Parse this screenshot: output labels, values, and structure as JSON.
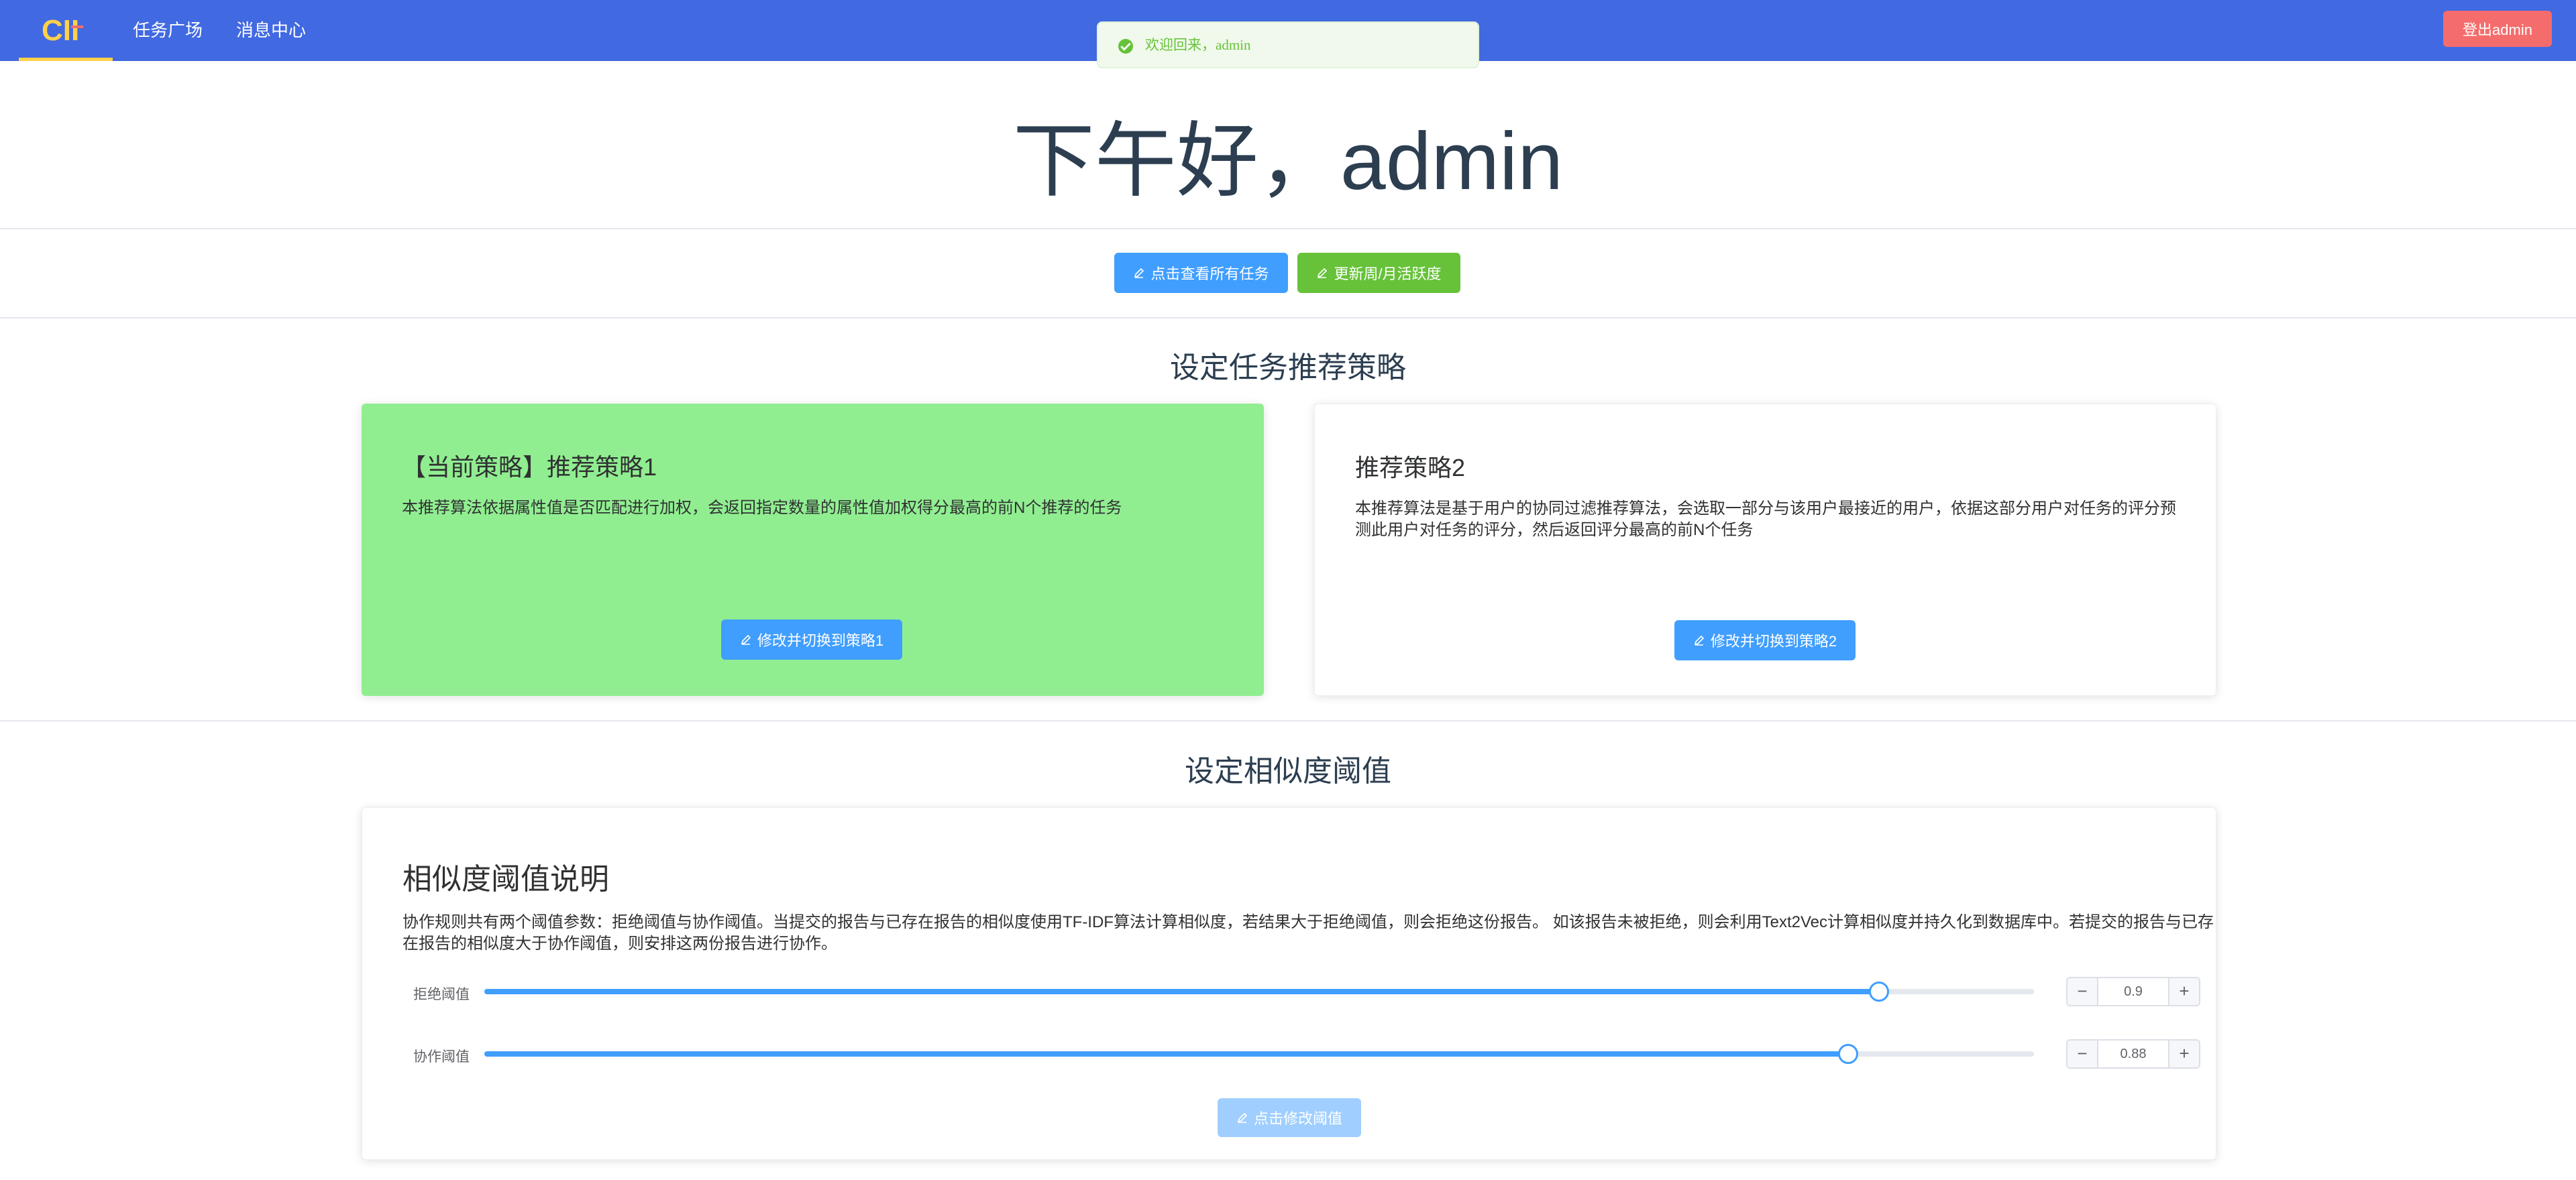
{
  "header": {
    "logo_text": "CII",
    "nav": [
      "任务广场",
      "消息中心"
    ],
    "logout_label": "登出admin"
  },
  "toast": {
    "icon": "success-check-icon",
    "message": "欢迎回来，admin"
  },
  "greeting": "下午好，admin",
  "actions": {
    "view_all_tasks": "点击查看所有任务",
    "update_activity": "更新周/月活跃度"
  },
  "strategy_section": {
    "title": "设定任务推荐策略",
    "cards": [
      {
        "title": "【当前策略】推荐策略1",
        "description": "本推荐算法依据属性值是否匹配进行加权，会返回指定数量的属性值加权得分最高的前N个推荐的任务",
        "button": "修改并切换到策略1",
        "active": true
      },
      {
        "title": "推荐策略2",
        "description": "本推荐算法是基于用户的协同过滤推荐算法，会选取一部分与该用户最接近的用户，依据这部分用户对任务的评分预测此用户对任务的评分，然后返回评分最高的前N个任务",
        "button": "修改并切换到策略2",
        "active": false
      }
    ]
  },
  "threshold_section": {
    "title": "设定相似度阈值",
    "card_title": "相似度阈值说明",
    "description": "协作规则共有两个阈值参数：拒绝阈值与协作阈值。当提交的报告与已存在报告的相似度使用TF-IDF算法计算相似度，若结果大于拒绝阈值，则会拒绝这份报告。 如该报告未被拒绝，则会利用Text2Vec计算相似度并持久化到数据库中。若提交的报告与已存在报告的相似度大于协作阈值，则安排这两份报告进行协作。",
    "sliders": [
      {
        "label": "拒绝阈值",
        "value": 0.9,
        "value_text": "0.9"
      },
      {
        "label": "协作阈值",
        "value": 0.88,
        "value_text": "0.88"
      }
    ],
    "stepper_minus": "−",
    "stepper_plus": "+",
    "submit_button": "点击修改阈值"
  },
  "colors": {
    "header": "#4169e1",
    "primary": "#409eff",
    "success": "#67c23a",
    "danger": "#f56c6c",
    "active_card": "#90ee90"
  }
}
